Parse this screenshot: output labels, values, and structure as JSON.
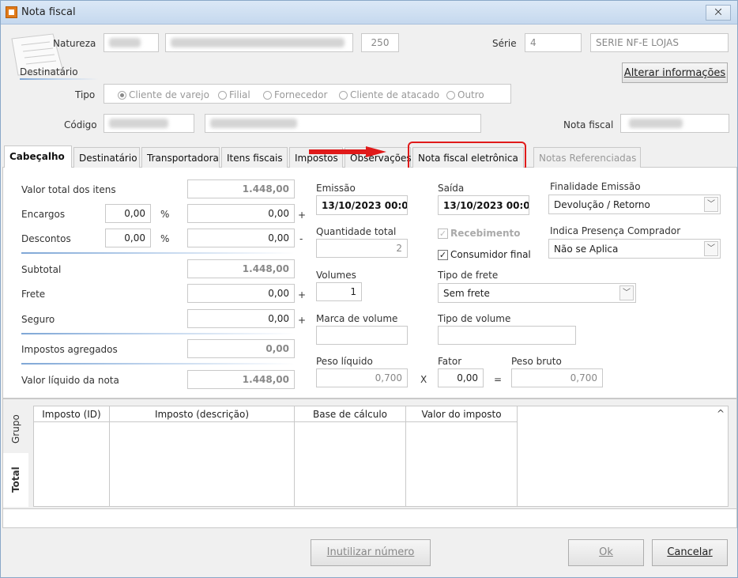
{
  "window": {
    "title": "Nota fiscal",
    "close_label": "⨉"
  },
  "header": {
    "natureza_label": "Natureza",
    "natureza_number": "250",
    "serie_label": "Série",
    "serie_value": "4",
    "serie_desc": "SERIE NF-E LOJAS",
    "destinatario_label": "Destinatário",
    "alterar_button": "Alterar informações",
    "tipo_label": "Tipo",
    "tipo_options": [
      "Cliente de varejo",
      "Filial",
      "Fornecedor",
      "Cliente de atacado",
      "Outro"
    ],
    "codigo_label": "Código",
    "nota_fiscal_label": "Nota fiscal"
  },
  "tabs": [
    "Cabeçalho",
    "Destinatário",
    "Transportadora",
    "Itens fiscais",
    "Impostos",
    "Observações",
    "Nota fiscal eletrônica",
    "Notas Referenciadas"
  ],
  "left": {
    "valor_total_label": "Valor total dos itens",
    "valor_total": "1.448,00",
    "encargos_label": "Encargos",
    "encargos_pct": "0,00",
    "encargos_val": "0,00",
    "descontos_label": "Descontos",
    "descontos_pct": "0,00",
    "descontos_val": "0,00",
    "pct_symbol": "%",
    "plus": "+",
    "minus": "-",
    "subtotal_label": "Subtotal",
    "subtotal": "1.448,00",
    "frete_label": "Frete",
    "frete": "0,00",
    "seguro_label": "Seguro",
    "seguro": "0,00",
    "impostos_label": "Impostos agregados",
    "impostos": "0,00",
    "liquido_label": "Valor líquido da nota",
    "liquido": "1.448,00"
  },
  "middle": {
    "emissao_label": "Emissão",
    "emissao": "13/10/2023 00:0",
    "saida_label": "Saída",
    "saida": "13/10/2023 00:0",
    "qtd_label": "Quantidade total",
    "qtd": "2",
    "recebimento_label": "Recebimento",
    "consumidor_label": "Consumidor final",
    "check_mark": "✓",
    "volumes_label": "Volumes",
    "volumes": "1",
    "tipo_frete_label": "Tipo de frete",
    "tipo_frete": "Sem frete",
    "marca_label": "Marca de volume",
    "tipo_volume_label": "Tipo de volume",
    "peso_liq_label": "Peso líquido",
    "peso_liq": "0,700",
    "x_symbol": "X",
    "fator_label": "Fator",
    "fator": "0,00",
    "eq_symbol": "=",
    "peso_bruto_label": "Peso bruto",
    "peso_bruto": "0,700"
  },
  "right": {
    "finalidade_label": "Finalidade Emissão",
    "finalidade": "Devolução / Retorno",
    "presenca_label": "Indica Presença Comprador",
    "presenca": "Não se Aplica",
    "dropdown_glyph": "﹀"
  },
  "bottom": {
    "vtabs": [
      "Grupo",
      "Total"
    ],
    "columns": [
      "Imposto (ID)",
      "Imposto (descrição)",
      "Base de cálculo",
      "Valor do imposto"
    ],
    "scroll_up": "^"
  },
  "footer": {
    "inutilizar": "Inutilizar número",
    "ok": "Ok",
    "cancelar": "Cancelar"
  },
  "colors": {
    "highlight": "#e01a1a",
    "accent": "#7fa7d6"
  }
}
